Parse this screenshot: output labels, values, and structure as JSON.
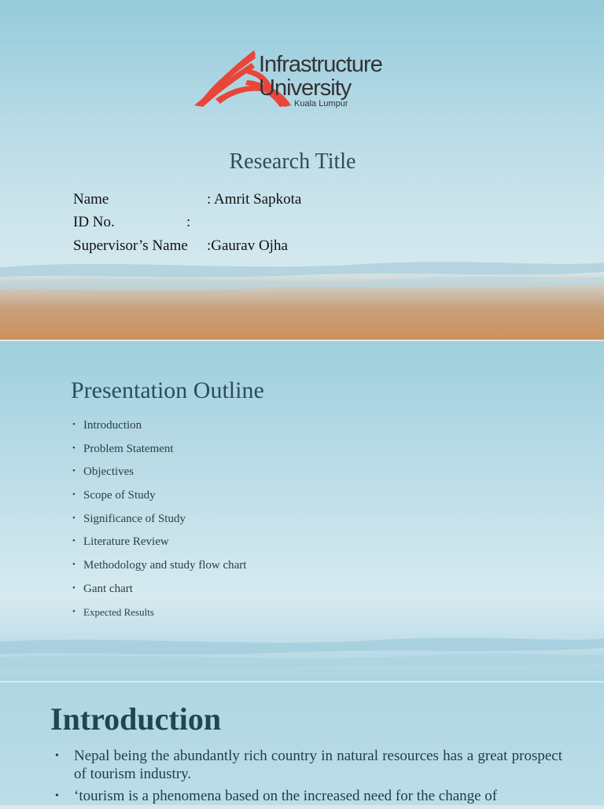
{
  "slide1": {
    "logo": {
      "line1": "Infrastructure",
      "line2": "University",
      "line3": "Kuala Lumpur",
      "color": "#e9463a"
    },
    "title": "Research Title",
    "fields": [
      {
        "label": "Name",
        "value": ": Amrit Sapkota"
      },
      {
        "label": "ID No.",
        "value": ":"
      },
      {
        "label": "Supervisor’s Name",
        "value": ":Gaurav Ojha"
      }
    ]
  },
  "slide2": {
    "title": "Presentation Outline",
    "items": [
      "Introduction",
      "Problem Statement",
      "Objectives",
      "Scope of Study",
      "Significance of Study",
      "Literature Review",
      "Methodology and study flow chart",
      "Gant chart",
      "Expected Results"
    ],
    "bullet": "•"
  },
  "slide3": {
    "title": "Introduction",
    "bullets": [
      "Nepal being the abundantly rich country in natural resources has a great prospect of tourism industry.",
      "‘tourism is a phenomena based on the increased need for the change of"
    ],
    "bullet": "•"
  },
  "colors": {
    "title_text": "#2c4d5b",
    "logo_red": "#e9463a"
  }
}
